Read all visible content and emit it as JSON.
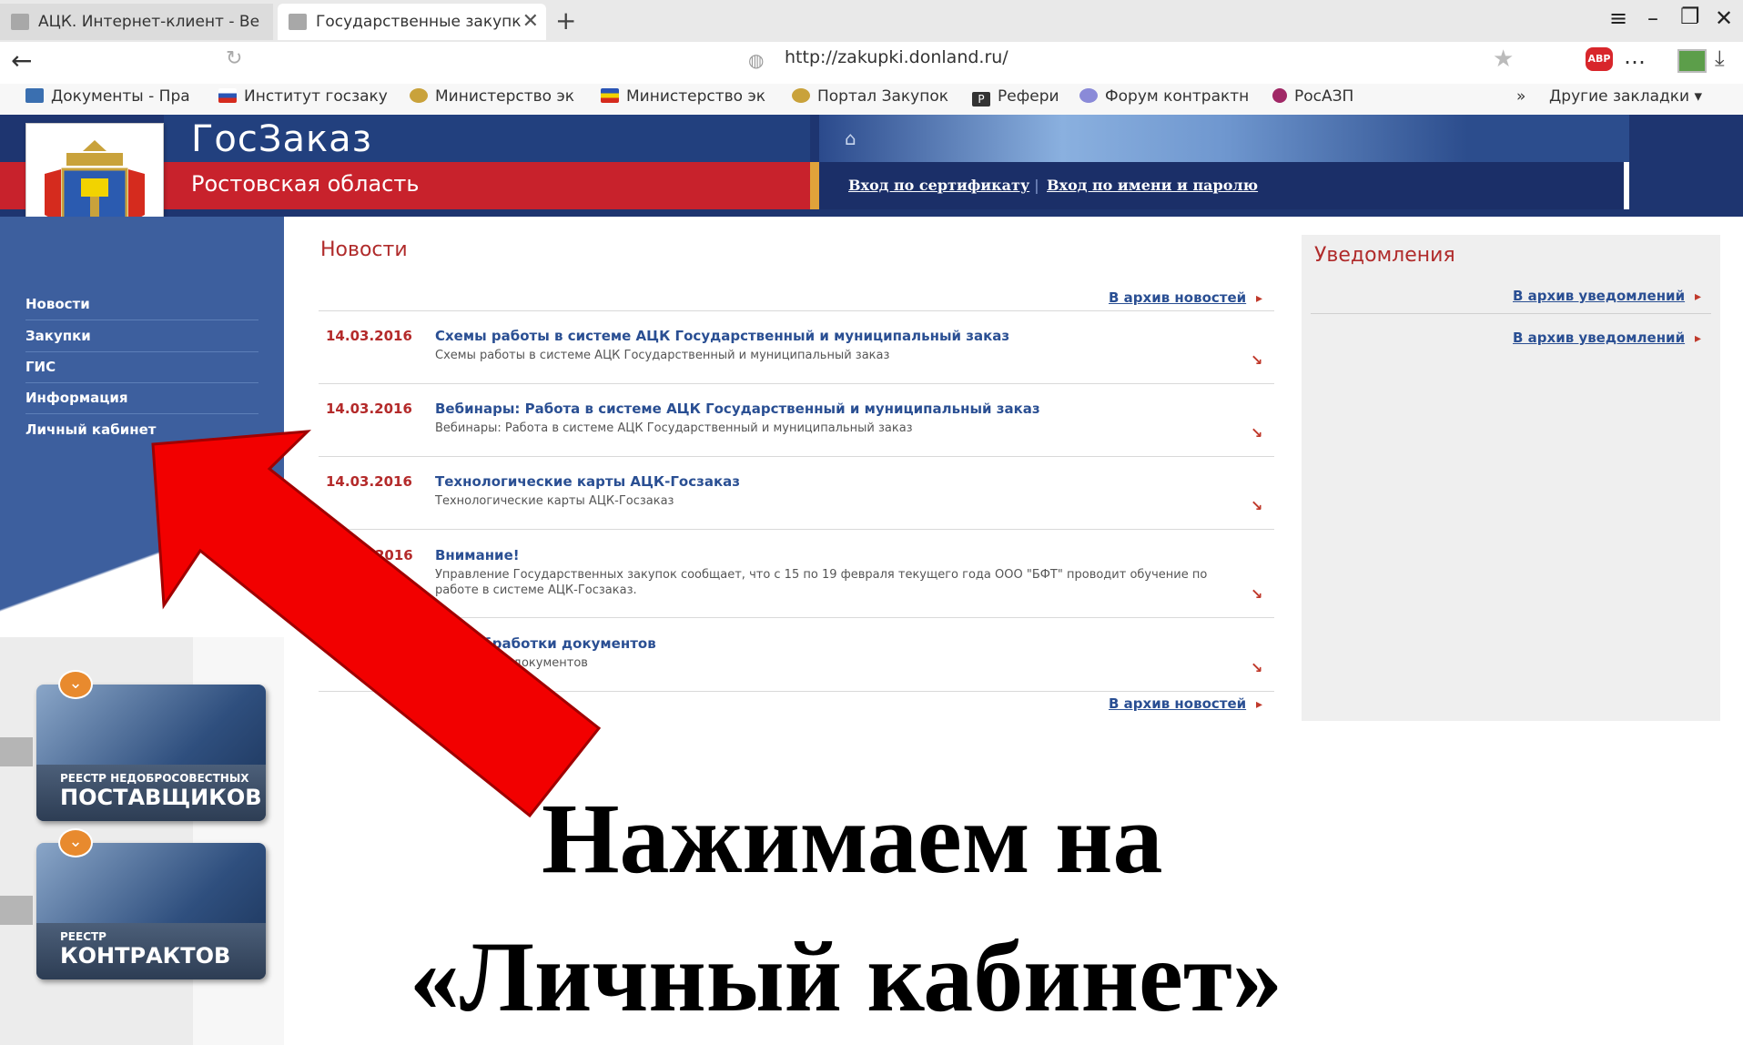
{
  "browser": {
    "tabs": [
      {
        "label": "АЦК. Интернет-клиент - Ве"
      },
      {
        "label": "Государственные закупк"
      }
    ],
    "url": "http://zakupki.donland.ru/",
    "abp_label": "ABP",
    "bookmarks": [
      {
        "label": "Документы - Пра"
      },
      {
        "label": "Институт госзаку"
      },
      {
        "label": "Министерство эк"
      },
      {
        "label": "Министерство эк"
      },
      {
        "label": "Портал Закупок"
      },
      {
        "label": "Рефери"
      },
      {
        "label": "Форум контрактн"
      },
      {
        "label": "РосАЗП"
      }
    ],
    "other_bookmarks": "Другие закладки"
  },
  "site": {
    "title": "ГосЗаказ",
    "region": "Ростовская область",
    "login_cert": "Вход по сертификату",
    "login_password": "Вход по имени и паролю"
  },
  "nav": [
    {
      "label": "Новости"
    },
    {
      "label": "Закупки"
    },
    {
      "label": "ГИС"
    },
    {
      "label": "Информация"
    },
    {
      "label": "Личный кабинет"
    }
  ],
  "banners": [
    {
      "small": "РЕЕСТР НЕДОБРОСОВЕСТНЫХ",
      "big": "ПОСТАВЩИКОВ"
    },
    {
      "small": "РЕЕСТР",
      "big": "КОНТРАКТОВ"
    }
  ],
  "news": {
    "title": "Новости",
    "archive_label": "В архив новостей",
    "items": [
      {
        "date": "14.03.2016",
        "headline": "Схемы работы в системе АЦК Государственный и муниципальный заказ",
        "text": "Схемы работы в системе АЦК Государственный и муниципальный заказ"
      },
      {
        "date": "14.03.2016",
        "headline": "Вебинары: Работа в системе АЦК Государственный и муниципальный заказ",
        "text": "Вебинары: Работа в системе АЦК Государственный и муниципальный заказ"
      },
      {
        "date": "14.03.2016",
        "headline": "Технологические карты АЦК-Госзаказ",
        "text": "Технологические карты АЦК-Госзаказ"
      },
      {
        "date": "2016",
        "headline": "Внимание!",
        "text": "Управление Государственных закупок сообщает, что с 15 по 19 февраля текущего года ООО \"БФТ\" проводит обучение по работе в системе АЦК-Госзаказ."
      },
      {
        "date": "",
        "headline": "обработки документов",
        "text": "ботки документов"
      }
    ]
  },
  "notifications": {
    "title": "Уведомления",
    "archive_label": "В архив уведомлений"
  },
  "caption": {
    "line1": "Нажимаем на",
    "line2": "«Личный кабинет»"
  },
  "colors": {
    "arrow": "#f20000",
    "header_blue": "#1e3570",
    "header_red": "#c8222c",
    "sidebar": "#3d5f9e"
  }
}
